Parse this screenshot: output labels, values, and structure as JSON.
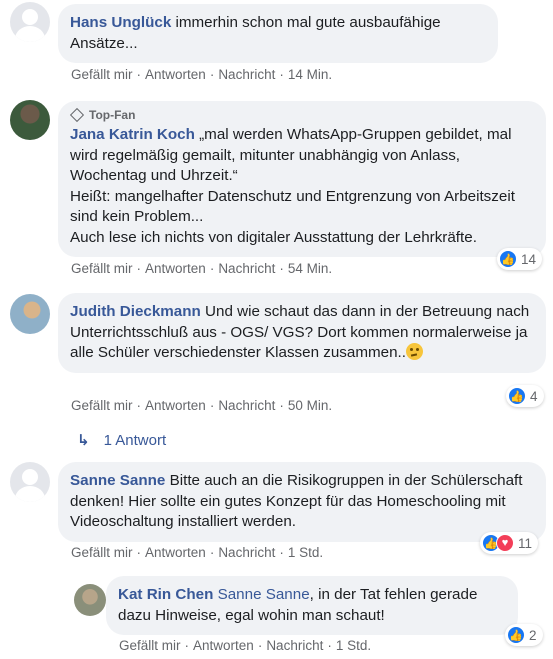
{
  "actions": {
    "like": "Gefällt mir",
    "reply": "Antworten",
    "message": "Nachricht",
    "sep": "·"
  },
  "comments": [
    {
      "author": "Hans Unglück",
      "text": " immerhin schon mal gute ausbaufähige Ansätze...",
      "time": "14 Min."
    },
    {
      "badge": "Top-Fan",
      "author": "Jana Katrin Koch",
      "text_lines": [
        " „mal werden WhatsApp-Gruppen gebildet, mal wird regelmäßig gemailt, mitunter unabhängig von Anlass, Wochentag und Uhrzeit.“",
        "Heißt: mangelhafter Datenschutz und Entgrenzung von Arbeitszeit sind kein Problem...",
        "Auch lese ich nichts von digitaler Ausstattung der Lehrkräfte."
      ],
      "time": "54 Min.",
      "reactions": {
        "count": "14"
      }
    },
    {
      "author": "Judith Dieckmann",
      "text": " Und wie schaut das dann in der Betreuung nach Unterrichtsschluß aus - OGS/ VGS? Dort kommen normalerweise ja alle Schüler verschiedenster Klassen zusammen..",
      "time": "50 Min.",
      "reactions": {
        "count": "4"
      },
      "replies_label": "1 Antwort"
    },
    {
      "author": "Sanne Sanne",
      "text": " Bitte auch an die Risikogruppen in der Schülerschaft denken! Hier sollte ein gutes Konzept für das Homeschooling mit Videoschaltung installiert werden.",
      "time": "1 Std.",
      "reactions": {
        "count": "11"
      }
    },
    {
      "author": "Kat Rin Chen",
      "mention": "Sanne Sanne",
      "text": ", in der Tat fehlen gerade dazu Hinweise, egal wohin man schaut!",
      "time": "1 Std.",
      "reactions": {
        "count": "2"
      }
    }
  ],
  "colors": {
    "link": "#385898",
    "bubble": "#f0f2f5",
    "like": "#1877f2",
    "love": "#f33e58"
  },
  "icons": [
    "top-fan-diamond-icon",
    "reply-arrow-icon",
    "like-reaction-icon",
    "love-reaction-icon",
    "thinking-emoji-icon"
  ]
}
